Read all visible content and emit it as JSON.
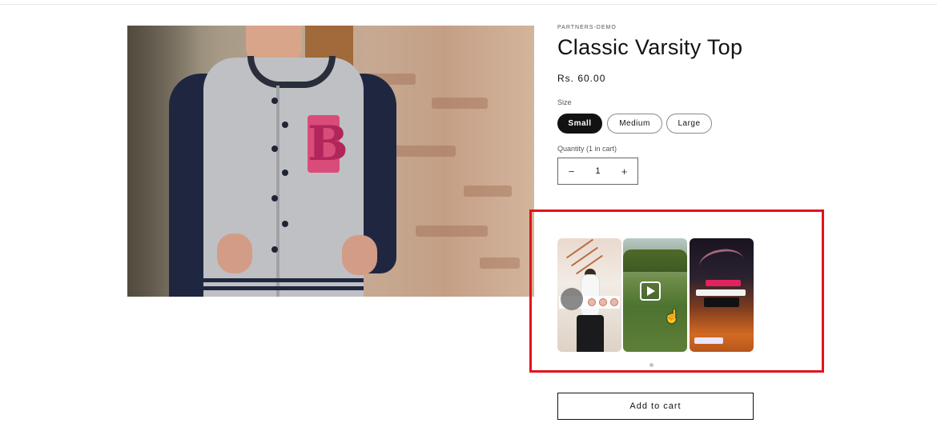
{
  "product": {
    "vendor": "PARTNERS-DEMO",
    "title": "Classic Varsity Top",
    "price": "Rs. 60.00"
  },
  "size": {
    "label": "Size",
    "options": [
      "Small",
      "Medium",
      "Large"
    ],
    "selected": "Small"
  },
  "quantity": {
    "label": "Quantity (1 in cart)",
    "value": "1",
    "decrease": "−",
    "increase": "+"
  },
  "video_carousel": {
    "highlight_color": "#e3121c",
    "items": [
      {
        "icon": "avatar-icon"
      },
      {
        "icon": "play-icon"
      },
      {
        "icon": "none"
      }
    ],
    "page_dots": 1
  },
  "actions": {
    "add_to_cart": "Add to cart"
  },
  "colors": {
    "text": "#121212",
    "selected_pill_bg": "#121212"
  }
}
